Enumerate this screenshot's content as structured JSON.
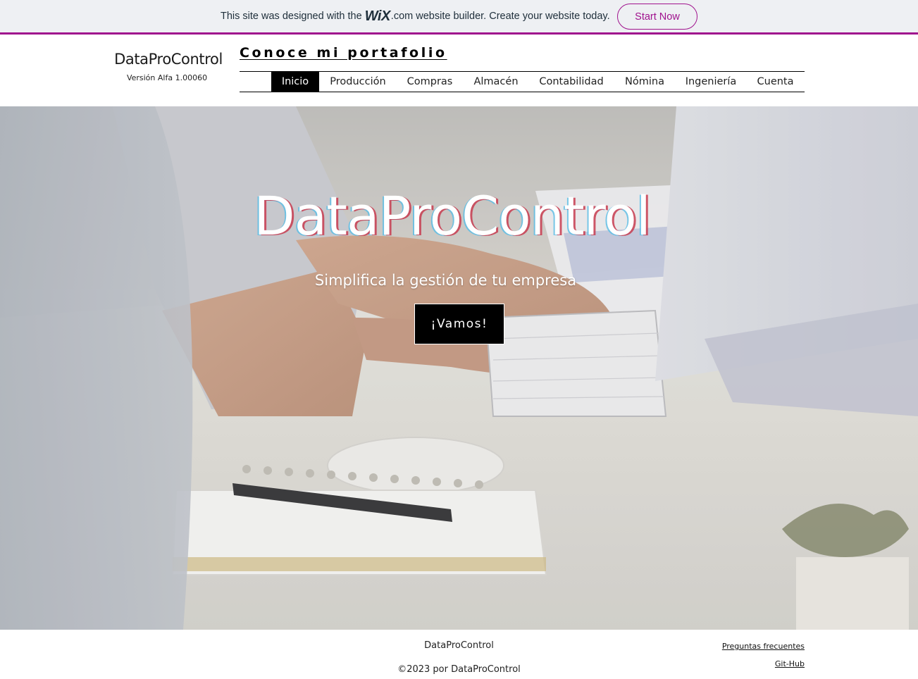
{
  "wix_banner": {
    "text_before": "This site was designed with the",
    "logo": "WiX",
    "text_after": ".com website builder. Create your website today.",
    "cta_label": "Start Now",
    "accent_color": "#a0138e"
  },
  "header": {
    "site_title": "DataProControl",
    "version": "Versión Alfa 1.00060",
    "portfolio_link": "Conoce mi portafolio",
    "nav": {
      "active": "Inicio",
      "items": [
        "Inicio",
        "Producción",
        "Compras",
        "Almacén",
        "Contabilidad",
        "Nómina",
        "Ingeniería",
        "Cuenta"
      ]
    }
  },
  "hero": {
    "title": "DataProControl",
    "subtitle": "Simplifica la gestión de tu empresa",
    "button_label": "¡Vamos!",
    "background_image": "office-desk-typing-image"
  },
  "footer": {
    "site_name": "DataProControl",
    "copyright": "©2023 por DataProControl",
    "links": [
      "Preguntas frecuentes",
      "Git-Hub"
    ]
  }
}
